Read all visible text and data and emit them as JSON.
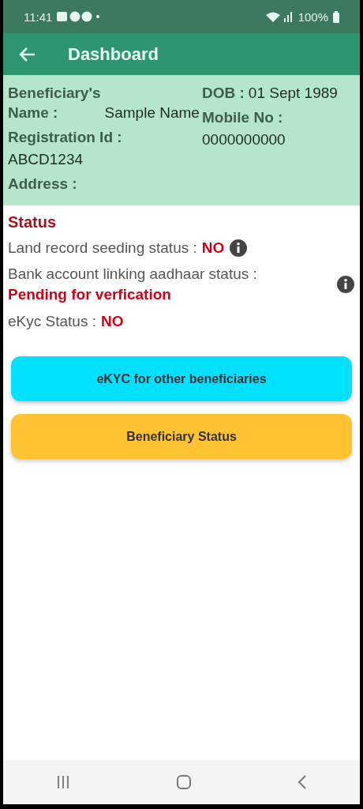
{
  "status_bar": {
    "time": "11:41",
    "battery": "100%"
  },
  "app_bar": {
    "title": "Dashboard"
  },
  "profile": {
    "left": [
      {
        "label": "Beneficiary's Name :",
        "value": "Sample Name",
        "kind": "inline"
      },
      {
        "label": "Registration Id :",
        "value": "ABCD1234",
        "kind": "stacked"
      },
      {
        "label": "Address :",
        "kind": "stacked"
      }
    ],
    "right": [
      {
        "label": "DOB :",
        "value": "01 Sept 1989",
        "kind": "inline"
      },
      {
        "label": "Mobile No :",
        "value": "0000000000",
        "kind": "stacked"
      }
    ]
  },
  "status": {
    "heading": "Status",
    "items": [
      {
        "label": "Land record seeding status :",
        "value": "NO",
        "kind": "inline",
        "info": true
      },
      {
        "label": "Bank account linking aadhaar status :",
        "value": "Pending for verfication",
        "kind": "stacked",
        "info": true
      },
      {
        "label": "eKyc Status :",
        "value": "NO",
        "kind": "inline",
        "info": false
      }
    ]
  },
  "buttons": [
    {
      "label": "eKYC for other beneficiaries",
      "color": "#00e0ff"
    },
    {
      "label": "Beneficiary Status",
      "color": "#ffc233"
    }
  ]
}
